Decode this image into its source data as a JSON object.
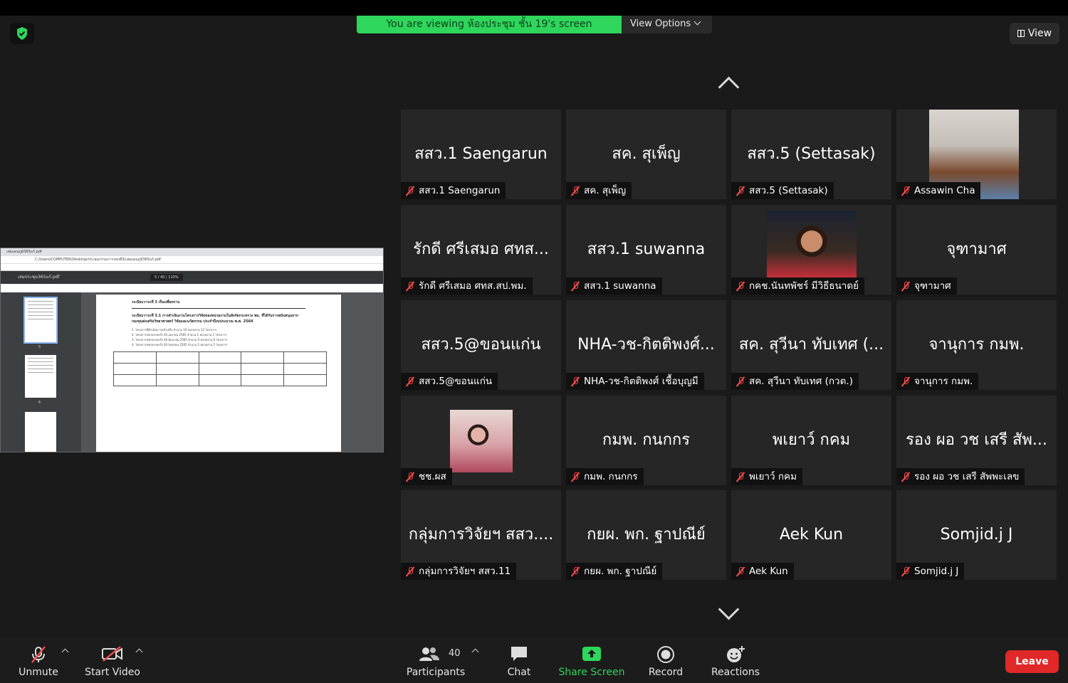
{
  "banner": {
    "viewing_text": "You are viewing ห้องประชุม ชั้น 19's screen",
    "view_options_label": "View Options"
  },
  "top_right": {
    "view_label": "View"
  },
  "shared_screen": {
    "tab_title": "เล่มแผนภูมิ365แก้.pdf",
    "address": "C:/Users/COMPUTER/Desktop/ประชุมกรรมการรอบที่3/เล่มแผนภูมิ365แก้.pdf",
    "pdf_name": "เล่มประชุม365แก้.pdf",
    "page_indicator": "5 / 40",
    "zoom": "110%",
    "thumb_pages": [
      "5",
      "6"
    ],
    "doc_heading": "ระเบียบวาระที่ 3        เรื่องเพื่อทราบ",
    "doc_sub": "ระเบียบวาระที่ 3.1   การดำเนินงานโครงการวิจัยของหน่วยงานในสังกัดกระทรวง พม. ที่ได้รับการสนับสนุนจากกองทุนส่งเสริมวิทยาศาสตร์ วิจัยและนวัตกรรม ประจำปีงบประมาณ พ.ศ. 2564",
    "doc_list": [
      "1. โครงการที่ดำเนินการแล้วเสร็จ จำนวน 10 หน่วยงาน 12 โครงการ",
      "2. โครงการขยายระยะถึง 30 เมษายน 2565 จำนวน 1 หน่วยงาน 1 โครงการ",
      "3. โครงการขยายระยะถึง 30 มิถุนายน 2565 จำนวน 5 หน่วยงาน 6 โครงการ",
      "4. โครงการขยายระยะถึง 30 กันยายน 2565 จำนวน 2 หน่วยงาน 5 โครงการ"
    ]
  },
  "participants": [
    {
      "display": "สสว.1 Saengarun",
      "name": "สสว.1 Saengarun",
      "video": false
    },
    {
      "display": "สค. สุเพ็ญ",
      "name": "สค. สุเพ็ญ",
      "video": false
    },
    {
      "display": "สสว.5 (Settasak)",
      "name": "สสว.5 (Settasak)",
      "video": false
    },
    {
      "display": "",
      "name": "Assawin Cha",
      "video": true
    },
    {
      "display": "รักดี  ศรีเสมอ ศทส...",
      "name": "รักดี  ศรีเสมอ ศทส.สป.พม.",
      "video": false
    },
    {
      "display": "สสว.1 suwanna",
      "name": "สสว.1 suwanna",
      "video": false
    },
    {
      "display": "",
      "name": "กคช.นันทพัชร์ มีวิธีธนาดย์",
      "video": true
    },
    {
      "display": "จุฑามาศ",
      "name": "จุฑามาศ",
      "video": false
    },
    {
      "display": "สสว.5@ขอนแก่น",
      "name": "สสว.5@ขอนแก่น",
      "video": false
    },
    {
      "display": "NHA-วช-กิตติพงศ์...",
      "name": "NHA-วช-กิตติพงศ์ เชื้อบุญมี",
      "video": false
    },
    {
      "display": "สค. สุวีนา ทับเทศ (...",
      "name": "สค. สุวีนา ทับเทศ (กวต.)",
      "video": false
    },
    {
      "display": "จานุการ กมพ.",
      "name": "จานุการ กมพ.",
      "video": false
    },
    {
      "display": "",
      "name": "ชช.ผส",
      "video": true
    },
    {
      "display": "กมพ. กนกกร",
      "name": "กมพ. กนกกร",
      "video": false
    },
    {
      "display": "พเยาว์ กคม",
      "name": "พเยาว์ กคม",
      "video": false
    },
    {
      "display": "รอง ผอ วช เสรี  สัพ...",
      "name": "รอง ผอ วช เสรี  สัพพะเลข",
      "video": false
    },
    {
      "display": "กลุ่มการวิจัยฯ สสว....",
      "name": "กลุ่มการวิจัยฯ สสว.11",
      "video": false
    },
    {
      "display": "กยผ. พก. ฐาปณีย์",
      "name": "กยผ. พก. ฐาปณีย์",
      "video": false
    },
    {
      "display": "Aek Kun",
      "name": "Aek Kun",
      "video": false
    },
    {
      "display": "Somjid.j J",
      "name": "Somjid.j J",
      "video": false
    }
  ],
  "toolbar": {
    "unmute": "Unmute",
    "start_video": "Start Video",
    "participants": "Participants",
    "participant_count": "40",
    "chat": "Chat",
    "share_screen": "Share Screen",
    "record": "Record",
    "reactions": "Reactions",
    "leave": "Leave"
  },
  "colors": {
    "banner": "#2ed65b",
    "leave": "#e02828",
    "share": "#2ed65b",
    "muted": "#ff4c4c"
  }
}
